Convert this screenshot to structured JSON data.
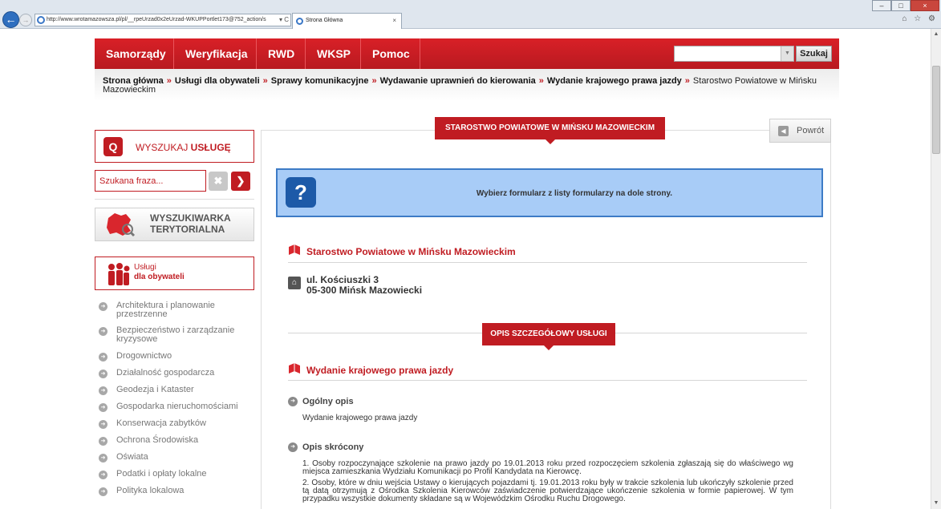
{
  "browser": {
    "address": "http://www.wrotamazowsza.pl/pl/__rpeUrzad0x2eUrzad-WKUPPortlet173@752_action/s",
    "address_controls": "▾ C",
    "tab_title": "Strona Główna",
    "tab_close": "×",
    "window_buttons": {
      "minimize": "–",
      "maximize": "□",
      "close": "×"
    },
    "back_glyph": "←",
    "forward_glyph": "→",
    "tool_icons": "⌂ ☆ ⚙"
  },
  "top_menu": {
    "items": [
      "Samorządy",
      "Weryfikacja",
      "RWD",
      "WKSP",
      "Pomoc"
    ],
    "search_value": "",
    "search_button": "Szukaj"
  },
  "breadcrumb": {
    "items": [
      "Strona główna",
      "Usługi dla obywateli",
      "Sprawy komunikacyjne",
      "Wydawanie uprawnień do kierowania",
      "Wydanie krajowego prawa jazdy"
    ],
    "current": "Starostwo Powiatowe w Mińsku Mazowieckim",
    "separator": "»"
  },
  "left": {
    "search_service": {
      "label_plain": "WYSZUKAJ ",
      "label_bold": "USŁUGĘ"
    },
    "phrase_placeholder": "Szukana fraza...",
    "clear_glyph": "✖",
    "go_glyph": "❯",
    "territorial": {
      "line1": "WYSZUKIWARKA",
      "line2": "TERYTORIALNA"
    },
    "citizens": {
      "line1": "Usługi",
      "line2": "dla obywateli"
    },
    "categories": [
      "Architektura i planowanie przestrzenne",
      "Bezpieczeństwo i zarządzanie kryzysowe",
      "Drogownictwo",
      "Działalność gospodarcza",
      "Geodezja i Kataster",
      "Gospodarka nieruchomościami",
      "Konserwacja zabytków",
      "Ochrona Środowiska",
      "Oświata",
      "Podatki i opłaty lokalne",
      "Polityka lokalowa"
    ]
  },
  "main": {
    "office_ribbon": "STAROSTWO POWIATOWE W MIŃSKU MAZOWIECKIM",
    "back_button": "Powrót",
    "info_text": "Wybierz formularz z listy formularzy na dole strony.",
    "office_title": "Starostwo Powiatowe w Mińsku Mazowieckim",
    "address_line1": "ul. Kościuszki 3",
    "address_line2": "05-300 Mińsk Mazowiecki",
    "detail_ribbon": "OPIS SZCZEGÓŁOWY USŁUGI",
    "service_title": "Wydanie krajowego prawa jazdy",
    "general_heading": "Ogólny opis",
    "general_text": "Wydanie krajowego prawa jazdy",
    "short_heading": "Opis skrócony",
    "short_p1": "1.   Osoby rozpoczynające szkolenie na prawo jazdy po 19.01.2013 roku przed rozpoczęciem szkolenia zgłaszają się do właściwego wg miejsca zamieszkania Wydziału Komunikacji po Profil Kandydata na Kierowcę.",
    "short_p2": "2.   Osoby, które w dniu wejścia Ustawy o kierujących pojazdami tj. 19.01.2013 roku były w trakcie szkolenia lub ukończyły szkolenie przed tą datą otrzymują z Ośrodka Szkolenia Kierowców zaświadczenie potwierdzające ukończenie szkolenia w formie papierowej. W tym przypadku wszystkie dokumenty składane są w Wojewódzkim Ośrodku Ruchu Drogowego."
  },
  "colors": {
    "brand_red": "#c01c22",
    "info_blue": "#a8ccf7",
    "info_border": "#3d7bc6"
  }
}
